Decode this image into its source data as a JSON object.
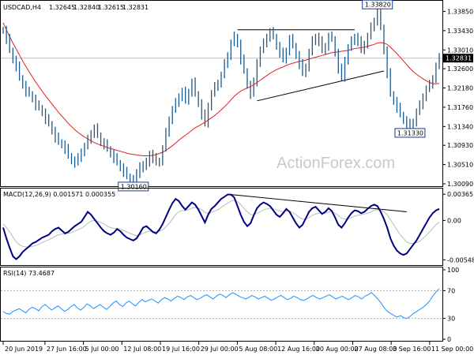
{
  "header": {
    "symbol": "USDCAD,H4",
    "open": "1.32645",
    "high": "1.32840",
    "low": "1.32615",
    "close": "1.32831"
  },
  "watermark": "ActionForex.com",
  "colors": {
    "price": "#1f5a8c",
    "ma": "#e02020",
    "macd": "#000080",
    "signal": "#bbbbbb",
    "rsi": "#1e90ff",
    "grid": "#e0e0e0",
    "ref": "#aaaaaa"
  },
  "chart_data": [
    {
      "type": "line",
      "name": "USDCAD,H4",
      "series": [
        {
          "values": [
            1.3345,
            1.3325,
            1.33,
            1.328,
            1.3265,
            1.324,
            1.3225,
            1.321,
            1.3205,
            1.3195,
            1.318,
            1.3175,
            1.3165,
            1.315,
            1.314,
            1.3125,
            1.311,
            1.31,
            1.3095,
            1.3085,
            1.307,
            1.306,
            1.3055,
            1.3065,
            1.308,
            1.309,
            1.3105,
            1.312,
            1.313,
            1.3115,
            1.31,
            1.3095,
            1.3085,
            1.3075,
            1.3065,
            1.3055,
            1.3045,
            1.3035,
            1.3025,
            1.302,
            1.3016,
            1.303,
            1.305,
            1.3045,
            1.3055,
            1.3075,
            1.3065,
            1.3055,
            1.306,
            1.3085,
            1.312,
            1.315,
            1.317,
            1.3185,
            1.32,
            1.321,
            1.319,
            1.321,
            1.323,
            1.3205,
            1.3185,
            1.316,
            1.314,
            1.318,
            1.3205,
            1.322,
            1.323,
            1.3245,
            1.327,
            1.329,
            1.3315,
            1.333,
            1.3315,
            1.328,
            1.3255,
            1.3225,
            1.3205,
            1.323,
            1.3275,
            1.33,
            1.3315,
            1.333,
            1.334,
            1.333,
            1.331,
            1.3295,
            1.328,
            1.33,
            1.3325,
            1.331,
            1.329,
            1.327,
            1.325,
            1.3265,
            1.3295,
            1.332,
            1.333,
            1.332,
            1.33,
            1.331,
            1.333,
            1.3325,
            1.3295,
            1.326,
            1.324,
            1.328,
            1.3305,
            1.332,
            1.333,
            1.332,
            1.33,
            1.3315,
            1.333,
            1.335,
            1.3365,
            1.3382,
            1.335,
            1.33,
            1.325,
            1.3205,
            1.319,
            1.3175,
            1.316,
            1.3148,
            1.314,
            1.3133,
            1.3145,
            1.3165,
            1.318,
            1.32,
            1.3215,
            1.3225,
            1.324,
            1.3265,
            1.3283
          ]
        }
      ],
      "ma": [
        1.336,
        1.3345,
        1.333,
        1.3316,
        1.3303,
        1.329,
        1.3277,
        1.3265,
        1.3253,
        1.3242,
        1.3231,
        1.3221,
        1.3211,
        1.3201,
        1.3192,
        1.3183,
        1.3174,
        1.3165,
        1.3157,
        1.3149,
        1.3141,
        1.3134,
        1.3127,
        1.3121,
        1.3116,
        1.3111,
        1.3107,
        1.3103,
        1.3099,
        1.3096,
        1.3093,
        1.3091,
        1.3088,
        1.3086,
        1.3084,
        1.3082,
        1.308,
        1.3078,
        1.3076,
        1.3074,
        1.3073,
        1.3072,
        1.3071,
        1.307,
        1.307,
        1.307,
        1.3071,
        1.3073,
        1.3075,
        1.3078,
        1.3082,
        1.3087,
        1.3092,
        1.3098,
        1.3104,
        1.311,
        1.3115,
        1.312,
        1.3126,
        1.3131,
        1.3135,
        1.3139,
        1.3143,
        1.3148,
        1.3153,
        1.3158,
        1.3164,
        1.317,
        1.3177,
        1.3184,
        1.3192,
        1.32,
        1.3206,
        1.3211,
        1.3215,
        1.3218,
        1.3221,
        1.3225,
        1.323,
        1.3235,
        1.324,
        1.3245,
        1.325,
        1.3254,
        1.3258,
        1.3261,
        1.3264,
        1.3267,
        1.327,
        1.3272,
        1.3274,
        1.3276,
        1.3277,
        1.3279,
        1.3281,
        1.3283,
        1.3285,
        1.3287,
        1.3289,
        1.3291,
        1.3293,
        1.3295,
        1.3296,
        1.3297,
        1.3298,
        1.3299,
        1.33,
        1.3302,
        1.3304,
        1.3305,
        1.3306,
        1.3307,
        1.3309,
        1.3311,
        1.3313,
        1.3316,
        1.3317,
        1.3316,
        1.3313,
        1.3307,
        1.33,
        1.3293,
        1.3285,
        1.3277,
        1.3269,
        1.3261,
        1.3254,
        1.3248,
        1.3243,
        1.3238,
        1.3234,
        1.323,
        1.3228,
        1.3227,
        1.3228
      ],
      "ylim": [
        1.3009,
        1.3403
      ],
      "y_ticks": [
        "1.30090",
        "1.30510",
        "1.30930",
        "1.31340",
        "1.31760",
        "1.32180",
        "1.32600",
        "1.33010",
        "1.33430",
        "1.33850"
      ],
      "y_tick_values": [
        1.3009,
        1.3051,
        1.3093,
        1.3134,
        1.3176,
        1.3218,
        1.326,
        1.3301,
        1.3343,
        1.3385
      ],
      "current_price": "1.32831",
      "annotations": [
        {
          "text": "1.30160",
          "value": 1.3016,
          "index": 40
        },
        {
          "text": "1.33820",
          "value": 1.3382,
          "index": 115
        },
        {
          "text": "1.31330",
          "value": 1.3133,
          "index": 125
        }
      ],
      "trendlines": [
        {
          "from": [
            72,
            1.3345
          ],
          "to": [
            108,
            1.3345
          ]
        },
        {
          "from": [
            78,
            1.319
          ],
          "to": [
            117,
            1.3255
          ]
        }
      ]
    },
    {
      "type": "line",
      "name": "MACD(12,26,9) 0.001571 0.000355",
      "series": [
        {
          "values": [
            -0.001,
            -0.0025,
            -0.0038,
            -0.005,
            -0.0054,
            -0.005,
            -0.0044,
            -0.004,
            -0.0036,
            -0.0032,
            -0.003,
            -0.0027,
            -0.0024,
            -0.0022,
            -0.002,
            -0.0015,
            -0.0012,
            -0.001,
            -0.0014,
            -0.0018,
            -0.0016,
            -0.0012,
            -0.0008,
            -0.0005,
            -0.0002,
            0.0005,
            0.0012,
            0.0008,
            0.0002,
            -0.0004,
            -0.001,
            -0.0015,
            -0.0018,
            -0.002,
            -0.0017,
            -0.0012,
            -0.0015,
            -0.002,
            -0.0024,
            -0.0026,
            -0.0028,
            -0.0025,
            -0.0018,
            -0.001,
            -0.0008,
            -0.0012,
            -0.0016,
            -0.0018,
            -0.0013,
            -0.0005,
            0.0005,
            0.0015,
            0.0024,
            0.003,
            0.0027,
            0.002,
            0.0015,
            0.002,
            0.0025,
            0.0022,
            0.0015,
            0.0006,
            -0.0003,
            0.0008,
            0.0016,
            0.002,
            0.0025,
            0.003,
            0.0033,
            0.0036,
            0.0036,
            0.0032,
            0.002,
            0.0008,
            -0.0002,
            -0.0008,
            -0.0004,
            0.0007,
            0.0017,
            0.0022,
            0.0025,
            0.0023,
            0.002,
            0.0014,
            0.0008,
            0.0005,
            0.001,
            0.0016,
            0.0012,
            0.0004,
            -0.0004,
            -0.001,
            -0.0006,
            0.0003,
            0.0012,
            0.0017,
            0.0019,
            0.0014,
            0.0009,
            0.0012,
            0.0017,
            0.0013,
            0.0004,
            -0.0006,
            -0.001,
            -0.0004,
            0.0004,
            0.001,
            0.0014,
            0.0013,
            0.001,
            0.0012,
            0.0016,
            0.002,
            0.0022,
            0.002,
            0.0012,
            0.0002,
            -0.001,
            -0.0025,
            -0.0035,
            -0.0042,
            -0.0046,
            -0.0048,
            -0.0046,
            -0.004,
            -0.0034,
            -0.0028,
            -0.002,
            -0.0012,
            -0.0004,
            0.0004,
            0.001,
            0.0014,
            0.0016
          ]
        },
        {
          "name": "signal",
          "values": [
            -0.0005,
            -0.001,
            -0.0016,
            -0.0023,
            -0.003,
            -0.0034,
            -0.0036,
            -0.0037,
            -0.0037,
            -0.0036,
            -0.0035,
            -0.0033,
            -0.0031,
            -0.0029,
            -0.0027,
            -0.0025,
            -0.0022,
            -0.002,
            -0.0019,
            -0.0019,
            -0.0018,
            -0.0017,
            -0.0015,
            -0.0013,
            -0.0011,
            -0.0008,
            -0.0004,
            -0.0001,
            0.0,
            -0.0001,
            -0.0003,
            -0.0005,
            -0.0008,
            -0.001,
            -0.0011,
            -0.0011,
            -0.0012,
            -0.0014,
            -0.0016,
            -0.0018,
            -0.002,
            -0.0021,
            -0.002,
            -0.0018,
            -0.0016,
            -0.0015,
            -0.0015,
            -0.0016,
            -0.0015,
            -0.0013,
            -0.0009,
            -0.0004,
            0.0002,
            0.0008,
            0.0012,
            0.0014,
            0.0014,
            0.0015,
            0.0017,
            0.0018,
            0.0017,
            0.0015,
            0.0011,
            0.001,
            0.0011,
            0.0013,
            0.0015,
            0.0018,
            0.0021,
            0.0024,
            0.0027,
            0.0028,
            0.0026,
            0.0022,
            0.0017,
            0.0012,
            0.0008,
            0.0008,
            0.001,
            0.0012,
            0.0015,
            0.0016,
            0.0017,
            0.0016,
            0.0015,
            0.0013,
            0.0012,
            0.0013,
            0.0013,
            0.0011,
            0.0008,
            0.0004,
            0.0002,
            0.0002,
            0.0004,
            0.0007,
            0.0009,
            0.001,
            0.001,
            0.001,
            0.0012,
            0.0012,
            0.001,
            0.0007,
            0.0003,
            0.0002,
            0.0002,
            0.0004,
            0.0006,
            0.0007,
            0.0008,
            0.0009,
            0.001,
            0.0012,
            0.0014,
            0.0015,
            0.0015,
            0.0012,
            0.0008,
            0.0001,
            -0.0006,
            -0.0013,
            -0.002,
            -0.0025,
            -0.003,
            -0.0032,
            -0.0032,
            -0.0031,
            -0.0029,
            -0.0025,
            -0.0021,
            -0.0016,
            -0.0011,
            -0.0006,
            -0.0002
          ]
        }
      ],
      "ylim": [
        -0.006,
        0.004
      ],
      "y_ticks": [
        "0.003651",
        "0.00",
        "-0.005489"
      ],
      "y_tick_values": [
        0.003651,
        0,
        -0.005489
      ],
      "trendlines": [
        {
          "from": [
            70,
            0.0036
          ],
          "to": [
            124,
            0.0012
          ]
        }
      ]
    },
    {
      "type": "line",
      "name": "RSI(14) 73.4687",
      "series": [
        {
          "values": [
            40,
            37,
            36,
            40,
            42,
            44,
            41,
            38,
            43,
            46,
            44,
            41,
            47,
            50,
            46,
            42,
            45,
            48,
            44,
            40,
            43,
            47,
            50,
            45,
            42,
            46,
            51,
            48,
            44,
            47,
            50,
            46,
            43,
            47,
            52,
            55,
            50,
            47,
            52,
            55,
            51,
            48,
            53,
            57,
            54,
            56,
            58,
            55,
            52,
            57,
            60,
            58,
            55,
            59,
            62,
            60,
            57,
            61,
            63,
            60,
            57,
            59,
            62,
            64,
            61,
            58,
            62,
            65,
            63,
            60,
            64,
            67,
            65,
            62,
            60,
            58,
            60,
            63,
            61,
            58,
            60,
            62,
            59,
            56,
            58,
            61,
            63,
            60,
            57,
            59,
            62,
            60,
            57,
            56,
            58,
            61,
            63,
            60,
            58,
            60,
            62,
            64,
            61,
            58,
            60,
            62,
            59,
            57,
            60,
            63,
            61,
            58,
            62,
            64,
            67,
            63,
            58,
            52,
            45,
            40,
            37,
            34,
            32,
            34,
            31,
            30,
            33,
            37,
            40,
            43,
            46,
            50,
            55,
            62,
            68,
            73
          ]
        }
      ],
      "ylim": [
        0,
        100
      ],
      "y_ticks": [
        "100",
        "70",
        "30",
        "0"
      ],
      "y_tick_values": [
        100,
        70,
        30,
        0
      ],
      "reference_lines": [
        70,
        30
      ]
    }
  ],
  "x_ticks": [
    {
      "label": "20 Jun 2019",
      "pos": 0
    },
    {
      "label": "27 Jun 16:00",
      "pos": 0.1004
    },
    {
      "label": "5 Jul 00:00",
      "pos": 0.1928
    },
    {
      "label": "12 Jul 08:00",
      "pos": 0.2851
    },
    {
      "label": "19 Jul 16:00",
      "pos": 0.3775
    },
    {
      "label": "29 Jul 00:00",
      "pos": 0.4699
    },
    {
      "label": "5 Aug 08:00",
      "pos": 0.5622
    },
    {
      "label": "12 Aug 16:00",
      "pos": 0.6546
    },
    {
      "label": "20 Aug 00:00",
      "pos": 0.747
    },
    {
      "label": "27 Aug 08:00",
      "pos": 0.8394
    },
    {
      "label": "3 Sep 16:00",
      "pos": 0.9317
    },
    {
      "label": "11 Sep 00:00",
      "pos": 1.0241
    }
  ]
}
